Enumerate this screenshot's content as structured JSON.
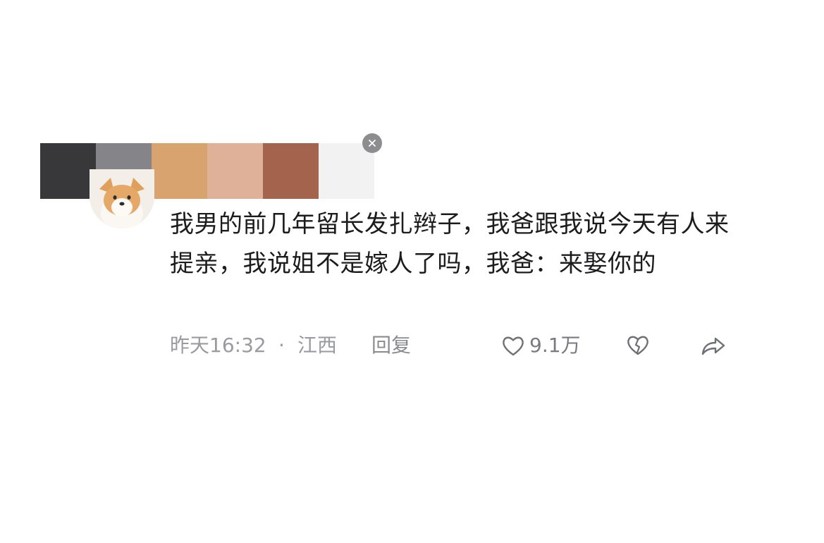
{
  "palette": {
    "colors": [
      "#38383b",
      "#858589",
      "#d9a36f",
      "#dfb199",
      "#a3634d",
      "#f2f2f3"
    ]
  },
  "comment": {
    "avatar_icon": "shiba-dog-avatar",
    "text": "我男的前几年留长发扎辫子，我爸跟我说今天有人来提亲，我说姐不是嫁人了吗，我爸：来娶你的",
    "time": "昨天16:32",
    "separator": "·",
    "location": "江西",
    "reply_label": "回复",
    "like_count": "9.1万"
  }
}
